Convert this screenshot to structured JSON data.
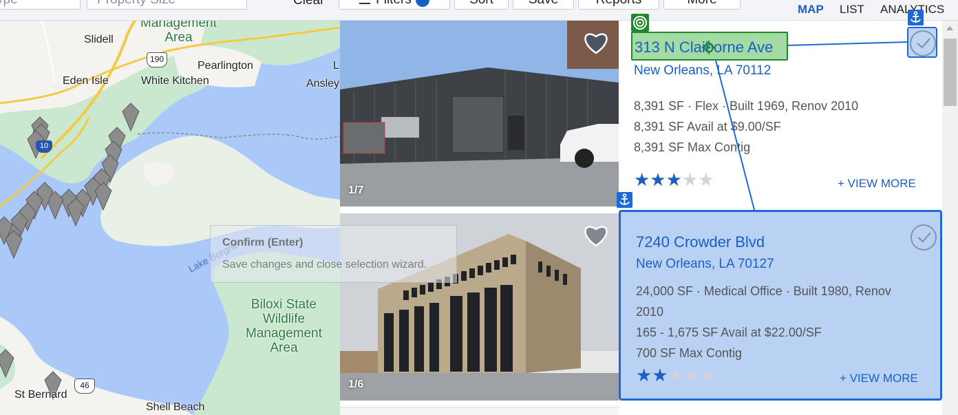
{
  "toolbar": {
    "property_type_text": "ype",
    "property_size_placeholder": "Property Size",
    "clear_label": "Clear",
    "filters_label": "Filters",
    "sort_label": "Sort",
    "save_label": "Save",
    "reports_label": "Reports",
    "more_label": "More"
  },
  "view_tabs": {
    "map": "MAP",
    "list": "LIST",
    "analytics": "ANALYTICS",
    "active": "map"
  },
  "map": {
    "labels": {
      "management_area": "Management\nArea",
      "slidell": "Slidell",
      "eden_isle": "Eden Isle",
      "white_kitchen": "White Kitchen",
      "pearlington": "Pearlington",
      "ansley": "Ansley",
      "l_partial": "L",
      "lake_borgne": "Lake Borgne",
      "biloxi": "Biloxi State\nWildlife\nManagement\nArea",
      "st_bernard": "St Bernard",
      "shell_beach": "Shell Beach",
      "hwy_190": "190",
      "hwy_46": "46",
      "hwy_10": "10"
    }
  },
  "tooltip": {
    "title": "Confirm (Enter)",
    "body": "Save changes and close selection wizard."
  },
  "listings": [
    {
      "address": "313 N Claiborne Ave",
      "city": "New Orleans, LA 70112",
      "details": "8,391 SF · Flex · Built 1969, Renov 2010",
      "avail": "8,391 SF Avail at $9.00/SF",
      "contig": "8,391 SF Max Contig",
      "rating": 3,
      "photo_counter": "1/7",
      "view_more": "+ VIEW MORE"
    },
    {
      "address": "7240 Crowder Blvd",
      "city": "New Orleans, LA 70127",
      "details_line1": "24,000 SF · Medical Office · Built 1980, Renov",
      "details_line2": "2010",
      "avail": "165 - 1,675 SF Avail at $22.00/SF",
      "contig": "700 SF Max Contig",
      "rating": 2,
      "photo_counter": "1/6",
      "view_more": "+ VIEW MORE"
    }
  ],
  "colors": {
    "accent": "#1a5fc2",
    "selection_blue": "#1e6ad4",
    "selection_green": "#1f8a2c",
    "map_water": "#aac8f8",
    "map_land": "#c9e8cf"
  },
  "icons": {
    "heart": "heart-icon",
    "check": "check-circle-icon",
    "anchor": "anchor-icon",
    "target": "target-icon",
    "map_pin": "map-pin-icon"
  }
}
